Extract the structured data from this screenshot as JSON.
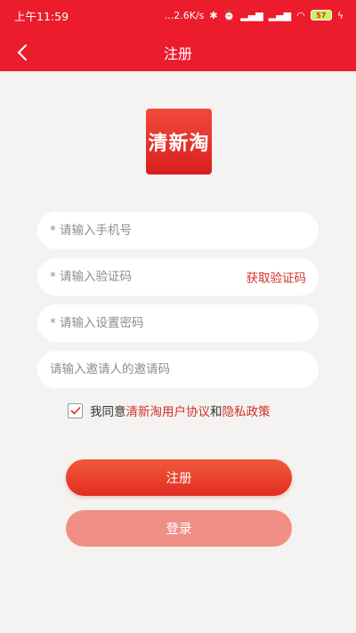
{
  "status_bar": {
    "time": "上午11:59",
    "network_speed": "...2.6K/s",
    "battery": "57"
  },
  "nav": {
    "title": "注册"
  },
  "logo": {
    "text": "清新淘"
  },
  "form": {
    "phone_placeholder": "* 请输入手机号",
    "code_placeholder": "* 请输入验证码",
    "get_code_label": "获取验证码",
    "password_placeholder": "* 请输入设置密码",
    "invite_placeholder": "请输入邀请人的邀请码"
  },
  "agreement": {
    "prefix": "我同意",
    "user_agreement": "清新淘用户协议",
    "and": "和",
    "privacy_policy": "隐私政策",
    "checked": true
  },
  "buttons": {
    "register": "注册",
    "login": "登录"
  },
  "colors": {
    "header": "#ec1c2d",
    "accent": "#d0312b",
    "register_button": "#e8412c",
    "login_button": "#f08f85"
  }
}
